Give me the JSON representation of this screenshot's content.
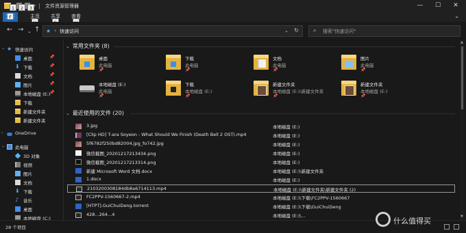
{
  "window": {
    "title": "文件资源管理器",
    "controls": [
      "—",
      "☐",
      "✕"
    ]
  },
  "ribbon": {
    "tabs": [
      {
        "label": "文件",
        "keytip": "F"
      },
      {
        "label": "主页",
        "keytip": "H"
      },
      {
        "label": "共享",
        "keytip": "S"
      },
      {
        "label": "查看",
        "keytip": "V"
      }
    ],
    "quick_access_keytips": [
      "1",
      "2",
      "3"
    ]
  },
  "address": {
    "path": "快速访问",
    "search_placeholder": "搜索\"快速访问\""
  },
  "sidebar": {
    "items": [
      {
        "label": "快速访问",
        "icon": "star-icon",
        "pinned": false
      },
      {
        "label": "桌面",
        "icon": "desktop-folder-icon",
        "pinned": true
      },
      {
        "label": "下载",
        "icon": "download-icon",
        "pinned": true
      },
      {
        "label": "文档",
        "icon": "documents-icon",
        "pinned": true
      },
      {
        "label": "图片",
        "icon": "pictures-icon",
        "pinned": true
      },
      {
        "label": "本地磁盘 (E:)",
        "icon": "drive-icon",
        "pinned": true
      },
      {
        "label": "下载",
        "icon": "folder-icon",
        "pinned": false
      },
      {
        "label": "新建文件夹",
        "icon": "folder-icon",
        "pinned": false
      },
      {
        "label": "新建文件夹",
        "icon": "folder-icon",
        "pinned": false
      },
      {
        "label": "OneDrive",
        "icon": "onedrive-icon",
        "pinned": false
      },
      {
        "label": "此电脑",
        "icon": "this-pc-icon",
        "pinned": false
      },
      {
        "label": "3D 对象",
        "icon": "3d-objects-icon",
        "pinned": false
      },
      {
        "label": "视频",
        "icon": "videos-icon",
        "pinned": false
      },
      {
        "label": "图片",
        "icon": "pictures-icon",
        "pinned": false
      },
      {
        "label": "文档",
        "icon": "documents-icon",
        "pinned": false
      },
      {
        "label": "下载",
        "icon": "download-icon",
        "pinned": false
      },
      {
        "label": "音乐",
        "icon": "music-icon",
        "pinned": false
      },
      {
        "label": "桌面",
        "icon": "desktop-folder-icon",
        "pinned": false
      },
      {
        "label": "本地磁盘 (C:)",
        "icon": "drive-icon",
        "pinned": false
      }
    ]
  },
  "frequent": {
    "header": "常用文件夹 (8)",
    "pin_glyph": "📌",
    "tiles": [
      {
        "name": "桌面",
        "location": "此电脑",
        "icon": "desktop-folder-icon",
        "pinned": true
      },
      {
        "name": "下载",
        "location": "此电脑",
        "icon": "download-folder-icon",
        "pinned": true
      },
      {
        "name": "文档",
        "location": "此电脑",
        "icon": "documents-folder-icon",
        "pinned": true
      },
      {
        "name": "图片",
        "location": "此电脑",
        "icon": "pictures-folder-icon",
        "pinned": true
      },
      {
        "name": "本地磁盘 (E:)",
        "location": "此电脑",
        "icon": "drive-icon",
        "pinned": true
      },
      {
        "name": "下载",
        "location": "本地磁盘 (E:)",
        "icon": "folder-icon",
        "pinned": true
      },
      {
        "name": "新建文件夹",
        "location": "本地磁盘 (E:)\\新建文件夹",
        "icon": "photo-folder-icon",
        "pinned": true
      },
      {
        "name": "新建文件夹",
        "location": "本地磁盘 (E:)",
        "icon": "photo-folder-icon",
        "pinned": true
      }
    ]
  },
  "recent": {
    "header": "最近使用的文件 (20)",
    "files": [
      {
        "name": "3.jpg",
        "location": "本地磁盘 (E:)",
        "kind": "jpg"
      },
      {
        "name": "[Clip HD] T-ara Soyeon - What Should We Finish (Death Bell 2 OST).mp4",
        "location": "本地磁盘 (E:)",
        "kind": "mp4"
      },
      {
        "name": "5f6782f250bd82004.jpg_fo742.jpg",
        "location": "本地磁盘 (E:)",
        "kind": "jpg"
      },
      {
        "name": "微信截图_20201217213434.png",
        "location": "本地磁盘 (E:)",
        "kind": "png-w"
      },
      {
        "name": "微信截图_20201217213314.png",
        "location": "本地磁盘 (E:)",
        "kind": "png-d"
      },
      {
        "name": "新建 Microsoft Word 文档.docx",
        "location": "本地磁盘 (E:)\\新建文件夹",
        "kind": "word"
      },
      {
        "name": "1.docx",
        "location": "本地磁盘 (E:)",
        "kind": "word"
      },
      {
        "name": "2103200308184db8a6714113.mp4",
        "location": "本地磁盘 (E:)\\新建文件夹\\新建文件夹 (2)",
        "kind": "mp4b",
        "selected": true
      },
      {
        "name": "FC2PPV-1560667-2.mp4",
        "location": "本地磁盘 (E:)\\下载\\FC2PPV-1560667",
        "kind": "mp4b"
      },
      {
        "name": "[HTPT].GuiChuiDeng.torrent",
        "location": "本地磁盘 (E:)\\下载\\GuiChuiDeng",
        "kind": "torrent"
      },
      {
        "name": "428...264...4",
        "location": "本地磁盘 (E:)\\...",
        "kind": "mp4b"
      }
    ]
  },
  "status": {
    "item_count": "28 个项目"
  },
  "watermark": {
    "text": "什么值得买"
  },
  "colors": {
    "accent": "#1c66b7",
    "background": "#191919",
    "folder": "#e4b33f"
  }
}
